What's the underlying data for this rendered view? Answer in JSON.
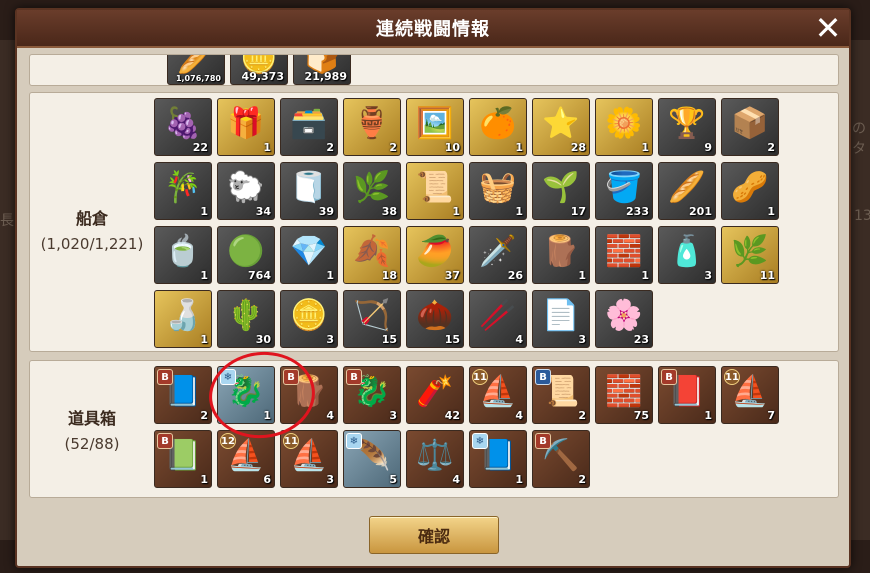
{
  "dialog": {
    "title": "連続戦闘情報",
    "close_label": "✕",
    "confirm_label": "確認"
  },
  "background": {
    "text_right_top": "のタ",
    "text_left_mid": "長",
    "text_right_mid": "13"
  },
  "top_strip": [
    {
      "qty": "1,076,780",
      "rarity": "gray",
      "glyph": "🥖",
      "small": true
    },
    {
      "qty": "49,373",
      "rarity": "gray",
      "glyph": "🪙",
      "small": false
    },
    {
      "qty": "21,989",
      "rarity": "gray",
      "glyph": "🍞",
      "small": false
    }
  ],
  "cargo": {
    "name": "船倉",
    "count": "(1,020/1,221)",
    "items": [
      {
        "qty": "22",
        "rarity": "gray",
        "glyph": "🍇",
        "icon": "berries-icon"
      },
      {
        "qty": "1",
        "rarity": "gold",
        "glyph": "🎁",
        "icon": "gift-box-icon"
      },
      {
        "qty": "2",
        "rarity": "gray",
        "glyph": "🗃️",
        "icon": "lacquer-box-icon"
      },
      {
        "qty": "2",
        "rarity": "gold",
        "glyph": "🏺",
        "icon": "jar-icon"
      },
      {
        "qty": "10",
        "rarity": "gold",
        "glyph": "🖼️",
        "icon": "folding-screen-icon"
      },
      {
        "qty": "1",
        "rarity": "gold",
        "glyph": "🍊",
        "icon": "orange-icon"
      },
      {
        "qty": "28",
        "rarity": "gold",
        "glyph": "⭐",
        "icon": "star-anise-icon"
      },
      {
        "qty": "1",
        "rarity": "gold",
        "glyph": "🌼",
        "icon": "flower-icon"
      },
      {
        "qty": "9",
        "rarity": "gray",
        "glyph": "🏆",
        "icon": "gold-statue-icon"
      },
      {
        "qty": "2",
        "rarity": "gray",
        "glyph": "📦",
        "icon": "wood-crate-icon"
      },
      {
        "qty": "1",
        "rarity": "gray",
        "glyph": "🎋",
        "icon": "bamboo-icon"
      },
      {
        "qty": "34",
        "rarity": "gray",
        "glyph": "🐑",
        "icon": "fur-icon"
      },
      {
        "qty": "39",
        "rarity": "gray",
        "glyph": "🧻",
        "icon": "silk-cloth-icon"
      },
      {
        "qty": "38",
        "rarity": "gray",
        "glyph": "🌿",
        "icon": "lemongrass-icon"
      },
      {
        "qty": "1",
        "rarity": "gold",
        "glyph": "📜",
        "icon": "scroll-painting-icon"
      },
      {
        "qty": "1",
        "rarity": "gray",
        "glyph": "🧺",
        "icon": "noodle-basket-icon"
      },
      {
        "qty": "17",
        "rarity": "gray",
        "glyph": "🌱",
        "icon": "herb-plant-icon"
      },
      {
        "qty": "233",
        "rarity": "gray",
        "glyph": "🪣",
        "icon": "wooden-bucket-icon"
      },
      {
        "qty": "201",
        "rarity": "gray",
        "glyph": "🥖",
        "icon": "bread-icon"
      },
      {
        "qty": "1",
        "rarity": "gray",
        "glyph": "🥜",
        "icon": "seeds-icon"
      },
      {
        "qty": "1",
        "rarity": "gray",
        "glyph": "🍵",
        "icon": "tea-bowl-icon"
      },
      {
        "qty": "764",
        "rarity": "gray",
        "glyph": "🟢",
        "icon": "green-stones-icon"
      },
      {
        "qty": "1",
        "rarity": "gray",
        "glyph": "💎",
        "icon": "amethyst-icon"
      },
      {
        "qty": "18",
        "rarity": "gold",
        "glyph": "🍂",
        "icon": "spice-pile-icon"
      },
      {
        "qty": "37",
        "rarity": "gold",
        "glyph": "🥭",
        "icon": "mango-icon"
      },
      {
        "qty": "26",
        "rarity": "gray",
        "glyph": "🗡️",
        "icon": "daggers-icon"
      },
      {
        "qty": "1",
        "rarity": "gray",
        "glyph": "🪵",
        "icon": "cinnamon-icon"
      },
      {
        "qty": "1",
        "rarity": "gray",
        "glyph": "🧱",
        "icon": "dark-slabs-icon"
      },
      {
        "qty": "3",
        "rarity": "gray",
        "glyph": "🧴",
        "icon": "bottle-icon"
      },
      {
        "qty": "11",
        "rarity": "gold",
        "glyph": "🌿",
        "icon": "leaf-branch-icon"
      },
      {
        "qty": "1",
        "rarity": "gold",
        "glyph": "🍶",
        "icon": "sake-bottle-icon"
      },
      {
        "qty": "30",
        "rarity": "gray",
        "glyph": "🌵",
        "icon": "cactus-icon"
      },
      {
        "qty": "3",
        "rarity": "gray",
        "glyph": "🪙",
        "icon": "silver-ingots-icon"
      },
      {
        "qty": "15",
        "rarity": "gray",
        "glyph": "🏹",
        "icon": "bows-icon"
      },
      {
        "qty": "15",
        "rarity": "gray",
        "glyph": "🌰",
        "icon": "dark-seeds-icon"
      },
      {
        "qty": "4",
        "rarity": "gray",
        "glyph": "🥢",
        "icon": "spears-icon"
      },
      {
        "qty": "3",
        "rarity": "gray",
        "glyph": "📄",
        "icon": "silver-sheet-icon"
      },
      {
        "qty": "23",
        "rarity": "gray",
        "glyph": "🌸",
        "icon": "ginseng-icon"
      }
    ]
  },
  "tools": {
    "name": "道具箱",
    "count": "(52/88)",
    "items": [
      {
        "qty": "2",
        "rarity": "brown",
        "glyph": "📘",
        "badge": "B",
        "badge_style": "red",
        "icon": "skill-book-icon"
      },
      {
        "qty": "1",
        "rarity": "steel",
        "glyph": "🐉",
        "badge": "❄",
        "badge_style": "ice",
        "icon": "dragon-figurehead-icon"
      },
      {
        "qty": "4",
        "rarity": "brown",
        "glyph": "🪵",
        "badge": "B",
        "badge_style": "red",
        "icon": "wood-beam-icon"
      },
      {
        "qty": "3",
        "rarity": "brown",
        "glyph": "🐉",
        "badge": "B",
        "badge_style": "red",
        "icon": "figurehead-icon"
      },
      {
        "qty": "42",
        "rarity": "brown",
        "glyph": "🧨",
        "badge": "",
        "badge_style": "red",
        "icon": "cannon-icon"
      },
      {
        "qty": "4",
        "rarity": "brown",
        "glyph": "⛵",
        "badge": "11",
        "badge_style": "gold",
        "icon": "ship-blueprint-icon"
      },
      {
        "qty": "2",
        "rarity": "brown",
        "glyph": "📜",
        "badge": "B",
        "badge_style": "blue",
        "icon": "map-scroll-icon"
      },
      {
        "qty": "75",
        "rarity": "brown",
        "glyph": "🧱",
        "badge": "",
        "badge_style": "red",
        "icon": "plank-stack-icon"
      },
      {
        "qty": "1",
        "rarity": "brown",
        "glyph": "📕",
        "badge": "B",
        "badge_style": "red",
        "icon": "manual-book-icon"
      },
      {
        "qty": "7",
        "rarity": "brown",
        "glyph": "⛵",
        "badge": "11",
        "badge_style": "gold",
        "icon": "ship-plan-icon"
      },
      {
        "qty": "1",
        "rarity": "brown",
        "glyph": "📗",
        "badge": "B",
        "badge_style": "red",
        "icon": "horn-book-icon"
      },
      {
        "qty": "6",
        "rarity": "brown",
        "glyph": "⛵",
        "badge": "12",
        "badge_style": "gold",
        "icon": "galleon-plan-icon"
      },
      {
        "qty": "3",
        "rarity": "brown",
        "glyph": "⛵",
        "badge": "11",
        "badge_style": "gold",
        "icon": "sail-plan-icon"
      },
      {
        "qty": "5",
        "rarity": "steel",
        "glyph": "🪶",
        "badge": "❄",
        "badge_style": "ice",
        "icon": "feather-quill-icon"
      },
      {
        "qty": "4",
        "rarity": "brown",
        "glyph": "⚖️",
        "badge": "",
        "badge_style": "red",
        "icon": "scales-scroll-icon"
      },
      {
        "qty": "1",
        "rarity": "brown",
        "glyph": "📘",
        "badge": "❄",
        "badge_style": "ice",
        "icon": "purple-book-icon"
      },
      {
        "qty": "2",
        "rarity": "brown",
        "glyph": "⛏️",
        "badge": "B",
        "badge_style": "red",
        "icon": "pickaxe-book-icon"
      }
    ]
  },
  "colors": {
    "title_bar": "#4a2719",
    "dialog_bg": "#d6ccbc",
    "highlight": "#e0141e",
    "confirm": "#e0b860"
  }
}
